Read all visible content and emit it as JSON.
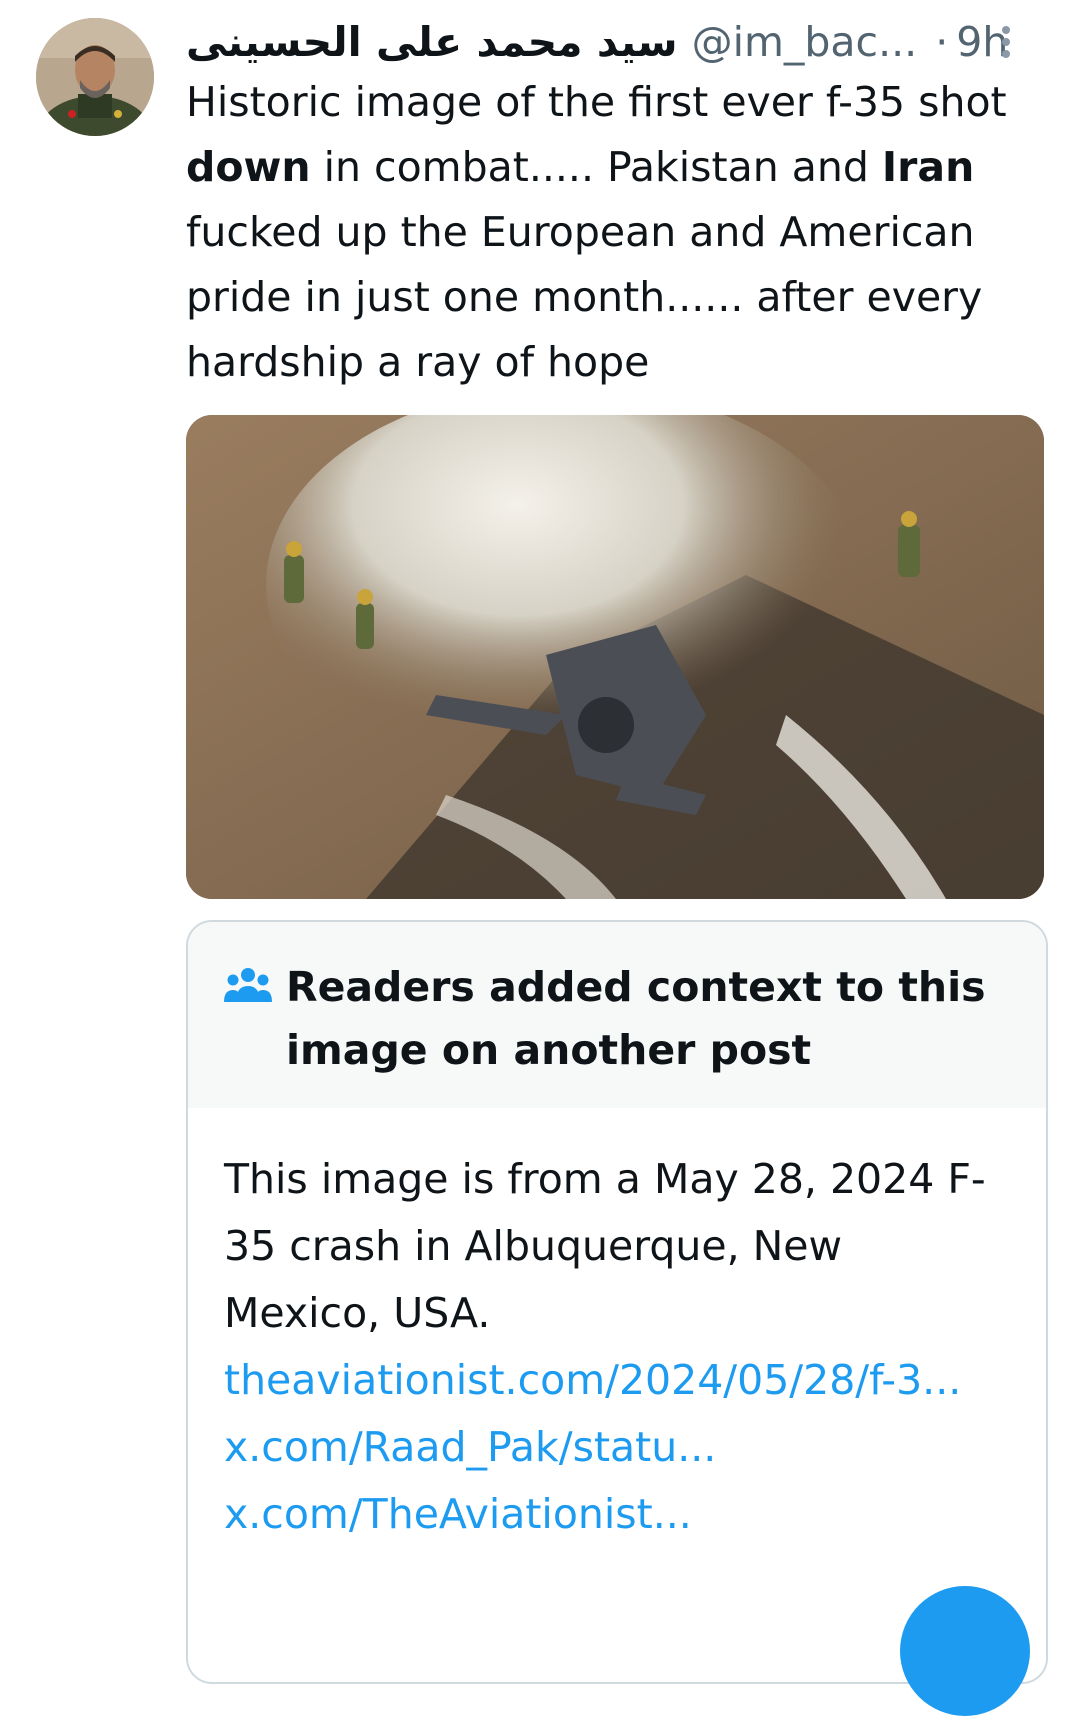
{
  "tweet": {
    "avatar_icon": "user-avatar-icon",
    "display_name": "سيد محمد على الحسينى",
    "handle": "@im_bac...",
    "separator": "·",
    "time": "9h",
    "more_icon": "more-options-icon",
    "text_segments": [
      {
        "text": "Historic image of the first ever f-35 shot ",
        "bold": false
      },
      {
        "text": "down",
        "bold": true
      },
      {
        "text": " in combat..... Pakistan and ",
        "bold": false
      },
      {
        "text": "Iran",
        "bold": true
      },
      {
        "text": " fucked up the European and American pride in just one month...... after every hardship a ray of hope",
        "bold": false
      }
    ],
    "media_description_icon": "crash-photo-image"
  },
  "community_note": {
    "icon": "people-group-icon",
    "title": "Readers added context to this image on another post",
    "body": "This image is from a May 28, 2024 F-35 crash in Albuquerque, New Mexico, USA.",
    "links": [
      "theaviationist.com/2024/05/28/f-3...",
      "x.com/Raad_Pak/statu...",
      "x.com/TheAviationist..."
    ]
  },
  "colors": {
    "text_primary": "#0f1419",
    "text_secondary": "#536471",
    "link": "#1d9bf0",
    "note_border": "#cfd9de",
    "note_header_bg": "#f7f9f9"
  }
}
